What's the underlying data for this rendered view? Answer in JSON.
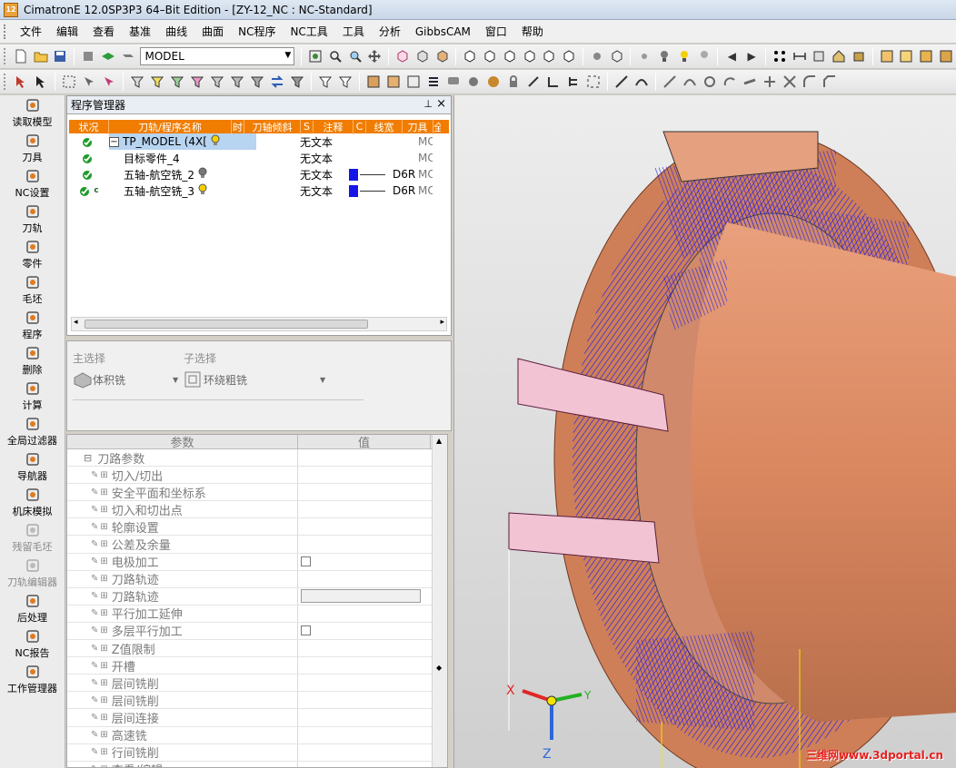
{
  "window": {
    "title": "CimatronE 12.0SP3P3  64–Bit Edition - [ZY-12_NC : NC-Standard]",
    "app_icon_text": "12"
  },
  "menu": [
    "文件",
    "编辑",
    "查看",
    "基准",
    "曲线",
    "曲面",
    "NC程序",
    "NC工具",
    "工具",
    "分析",
    "GibbsCAM",
    "窗口",
    "帮助"
  ],
  "toolbar": {
    "model_select": "MODEL"
  },
  "left_toolbar": [
    {
      "label": "读取模型",
      "icon": "load-model-icon",
      "enabled": true
    },
    {
      "label": "刀具",
      "icon": "tool-icon",
      "enabled": true
    },
    {
      "label": "NC设置",
      "icon": "nc-setup-icon",
      "enabled": true
    },
    {
      "label": "刀轨",
      "icon": "toolpath-icon",
      "enabled": true
    },
    {
      "label": "零件",
      "icon": "part-icon",
      "enabled": true
    },
    {
      "label": "毛坯",
      "icon": "stock-icon",
      "enabled": true
    },
    {
      "label": "程序",
      "icon": "program-icon",
      "enabled": true
    },
    {
      "label": "删除",
      "icon": "delete-icon",
      "enabled": true
    },
    {
      "label": "计算",
      "icon": "compute-icon",
      "enabled": true
    },
    {
      "label": "全局过滤器",
      "icon": "filter-icon",
      "enabled": true
    },
    {
      "label": "导航器",
      "icon": "navigator-icon",
      "enabled": true
    },
    {
      "label": "机床模拟",
      "icon": "machine-sim-icon",
      "enabled": true
    },
    {
      "label": "残留毛坯",
      "icon": "remnant-stock-icon",
      "enabled": false
    },
    {
      "label": "刀轨编辑器",
      "icon": "toolpath-editor-icon",
      "enabled": false
    },
    {
      "label": "后处理",
      "icon": "post-process-icon",
      "enabled": true
    },
    {
      "label": "NC报告",
      "icon": "nc-report-icon",
      "enabled": true
    },
    {
      "label": "工作管理器",
      "icon": "job-manager-icon",
      "enabled": true
    }
  ],
  "program_manager": {
    "title": "程序管理器",
    "columns": [
      "状况",
      "刀轨/程序名称",
      "时",
      "刀轴倾斜",
      "S",
      "注释",
      "C",
      "线宽",
      "刀具",
      "全"
    ],
    "rows": [
      {
        "name": "TP_MODEL (4X[",
        "note": "无文本",
        "width": "",
        "tool": "",
        "last": "MC",
        "status": "ok",
        "selected": true,
        "bulb": "yellow",
        "expand": "−"
      },
      {
        "name": "目标零件_4",
        "note": "无文本",
        "width": "",
        "tool": "",
        "last": "MC",
        "status": "ok",
        "selected": false,
        "bulb": "",
        "expand": ""
      },
      {
        "name": "五轴-航空铣_2",
        "note": "无文本",
        "width": "D6R",
        "tool": "",
        "last": "MC",
        "status": "ok",
        "selected": false,
        "bulb": "gray",
        "expand": ""
      },
      {
        "name": "五轴-航空铣_3",
        "note": "无文本",
        "width": "D6R",
        "tool": "",
        "last": "MC",
        "status": "ok-c",
        "selected": false,
        "bulb": "yellow",
        "expand": ""
      }
    ]
  },
  "selection": {
    "main_label": "主选择",
    "main_value": "体积铣",
    "sub_label": "子选择",
    "sub_value": "环绕粗铣"
  },
  "params": {
    "col_param": "参数",
    "col_value": "值",
    "group": "刀路参数",
    "rows": [
      {
        "name": "切入/切出",
        "value": ""
      },
      {
        "name": "安全平面和坐标系",
        "value": ""
      },
      {
        "name": "切入和切出点",
        "value": ""
      },
      {
        "name": "轮廓设置",
        "value": ""
      },
      {
        "name": "公差及余量",
        "value": ""
      },
      {
        "name": "电极加工",
        "value": "checkbox"
      },
      {
        "name": "刀路轨迹",
        "value": ""
      },
      {
        "name": "刀路轨迹",
        "value": "bar"
      },
      {
        "name": "平行加工延伸",
        "value": ""
      },
      {
        "name": "多层平行加工",
        "value": "checkbox"
      },
      {
        "name": "Z值限制",
        "value": ""
      },
      {
        "name": "开槽",
        "value": ""
      },
      {
        "name": "层间铣削",
        "value": ""
      },
      {
        "name": "层间铣削",
        "value": ""
      },
      {
        "name": "层间连接",
        "value": ""
      },
      {
        "name": "高速铣",
        "value": ""
      },
      {
        "name": "行间铣削",
        "value": ""
      },
      {
        "name": "查看/编辑",
        "value": ""
      }
    ]
  },
  "viewport": {
    "axis_x": "X",
    "axis_y": "Y",
    "axis_z": "Z",
    "watermark": "三维网www.3dportal.cn"
  },
  "colors": {
    "part": "#e2936e",
    "toolpath": "#2a22e6",
    "toolpath_highlight": "#e98cc2",
    "column_header": "#f07d00"
  }
}
